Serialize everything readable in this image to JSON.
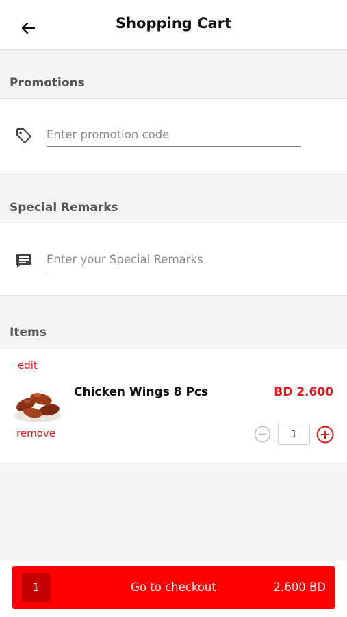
{
  "header": {
    "title": "Shopping Cart",
    "back_icon": "arrow-left-icon"
  },
  "promotions": {
    "label": "Promotions",
    "placeholder": "Enter promotion code",
    "value": "",
    "icon": "tag-icon"
  },
  "remarks": {
    "label": "Special Remarks",
    "placeholder": "Enter your Special Remarks",
    "value": "",
    "icon": "message-icon"
  },
  "items": {
    "label": "Items",
    "list": [
      {
        "edit_label": "edit",
        "remove_label": "remove",
        "name": "Chicken Wings 8 Pcs",
        "price": "BD 2.600",
        "quantity": "1"
      }
    ]
  },
  "checkout": {
    "count": "1",
    "label": "Go to checkout",
    "total": "2.600 BD"
  },
  "colors": {
    "accent": "#ff0000",
    "accent_text": "#e8171c",
    "badge": "#c50000",
    "background": "#f4f4f4"
  }
}
